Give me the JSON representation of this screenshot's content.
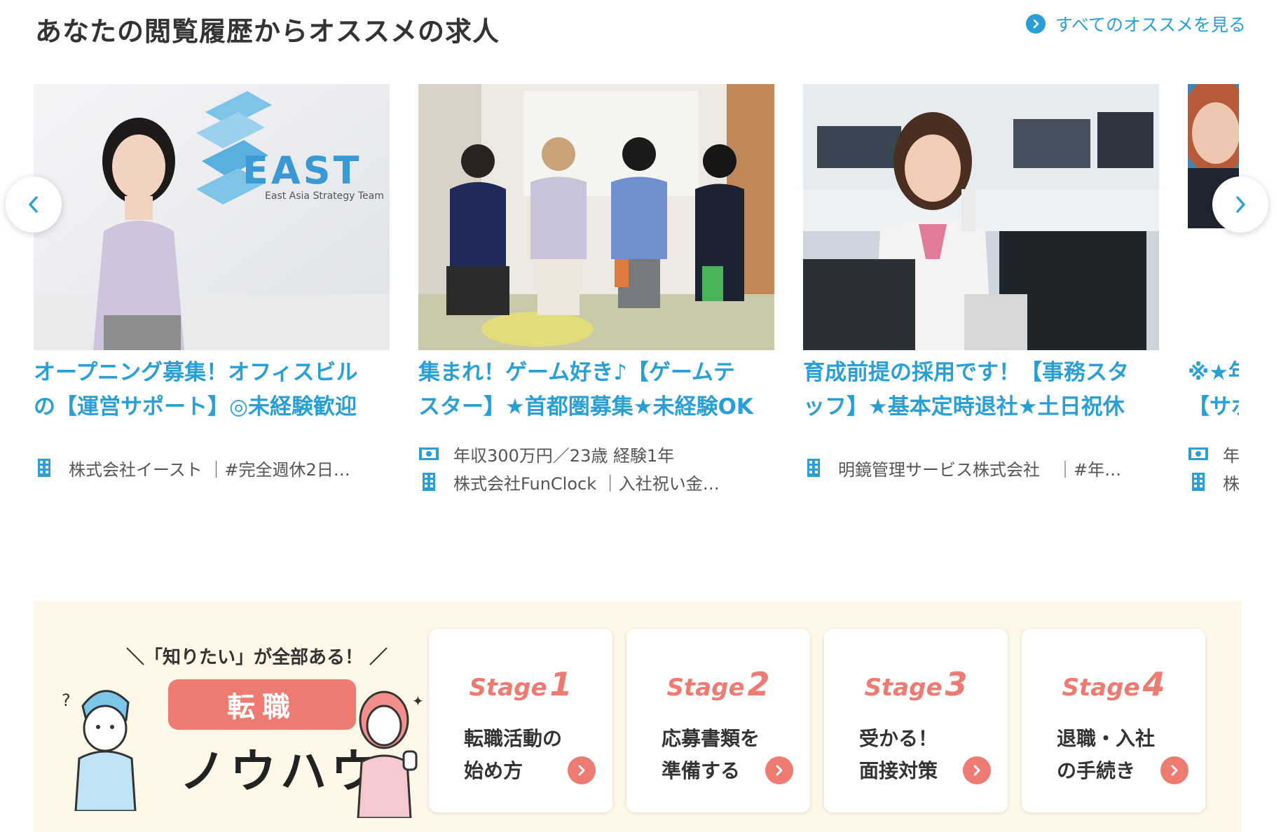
{
  "section": {
    "title": "あなたの閲覧履歴からオススメの求人",
    "see_all": "すべてのオススメを見る"
  },
  "cards": [
    {
      "title_line1": "オープニング募集！オフィスビル",
      "title_line2": "の【運営サポート】◎未経験歓迎",
      "salary": "",
      "company": "株式会社イースト ｜#完全週休2日…",
      "logo_text": "EAST",
      "logo_sub": "East Asia Strategy Team"
    },
    {
      "title_line1": "集まれ！ゲーム好き♪【ゲームテ",
      "title_line2": "スター】★首都圏募集★未経験OK",
      "salary": "年収300万円／23歳 経験1年",
      "company": "株式会社FunClock ｜入社祝い金…"
    },
    {
      "title_line1": "育成前提の採用です！【事務スタ",
      "title_line2": "ッフ】★基本定時退社★土日祝休",
      "salary": "",
      "company": "明鏡管理サービス株式会社　｜#年…"
    },
    {
      "title_line1": "※★年",
      "title_line2": "【サポ",
      "salary": "年",
      "company": "株"
    }
  ],
  "knowhow": {
    "tagline": "＼「知りたい」が全部ある！ ／",
    "pill": "転職",
    "big": "ノウハウ",
    "stages": [
      {
        "word": "Stage",
        "num": "1",
        "line1": "転職活動の",
        "line2": "始め方"
      },
      {
        "word": "Stage",
        "num": "2",
        "line1": "応募書類を",
        "line2": "準備する"
      },
      {
        "word": "Stage",
        "num": "3",
        "line1": "受かる！",
        "line2": "面接対策"
      },
      {
        "word": "Stage",
        "num": "4",
        "line1": "退職・入社",
        "line2": "の手続き"
      }
    ]
  },
  "icons": {
    "see_all": "chevron-right-circle-icon",
    "building": "building-icon",
    "salary": "banknote-icon",
    "prev": "chevron-left-icon",
    "next": "chevron-right-icon"
  },
  "colors": {
    "accent_blue": "#2a9fd6",
    "accent_coral": "#ee7b72",
    "knowhow_bg": "#fff8e8"
  }
}
